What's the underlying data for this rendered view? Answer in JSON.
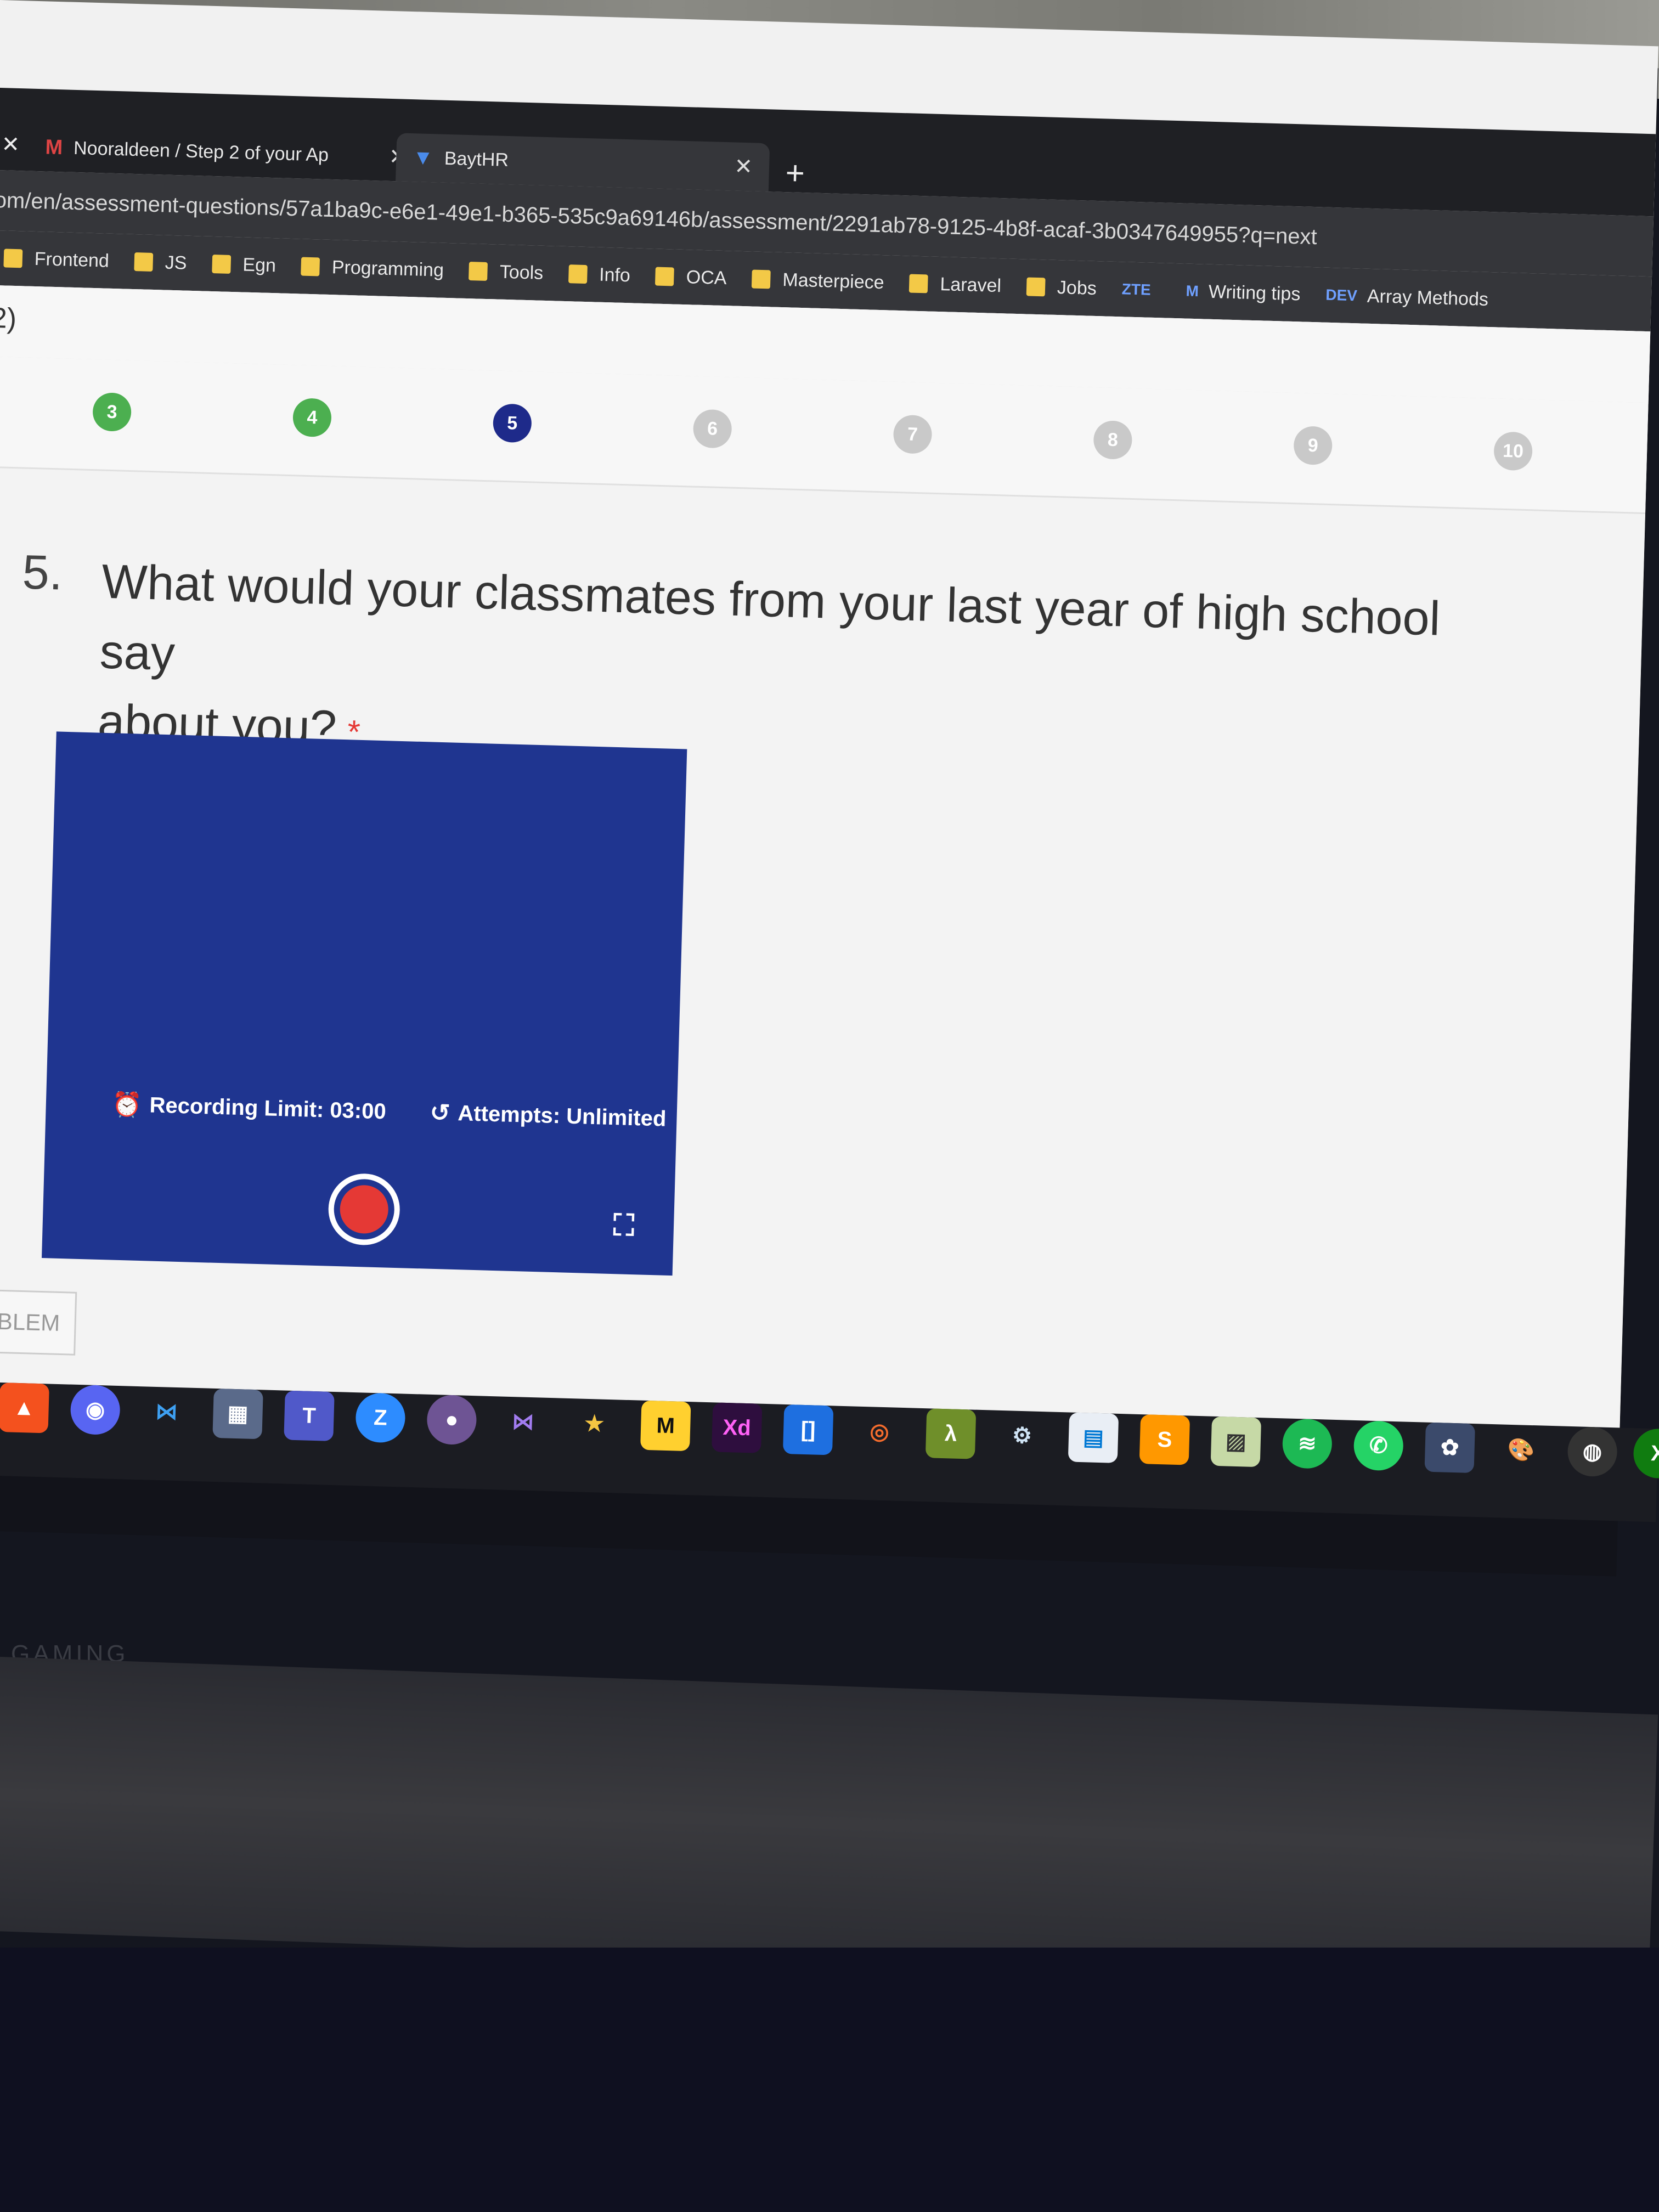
{
  "browser": {
    "tabs": [
      {
        "label": "Nooraldeen / Step 2 of your Ap",
        "icon": "gmail-icon"
      },
      {
        "label": "BaytHR",
        "icon": "bayt-icon",
        "active": true
      }
    ],
    "url": "om/en/assessment-questions/57a1ba9c-e6e1-49e1-b365-535c9a69146b/assessment/2291ab78-9125-4b8f-acaf-3b0347649955?q=next",
    "bookmarks": [
      "Frontend",
      "JS",
      "Egn",
      "Programming",
      "Tools",
      "Info",
      "OCA",
      "Masterpiece",
      "Laravel",
      "Jobs",
      "ZTE",
      "Writing tips",
      "Array Methods"
    ]
  },
  "page": {
    "header_fragment": "2)",
    "steps": [
      {
        "label": "3",
        "state": "done"
      },
      {
        "label": "4",
        "state": "done"
      },
      {
        "label": "5",
        "state": "current"
      },
      {
        "label": "6",
        "state": "todo"
      },
      {
        "label": "7",
        "state": "todo"
      },
      {
        "label": "8",
        "state": "todo"
      },
      {
        "label": "9",
        "state": "todo"
      },
      {
        "label": "10",
        "state": "todo"
      }
    ],
    "question": {
      "number": "5.",
      "line1": "What would your classmates from your last year of high school say",
      "line2": "about you?",
      "required_mark": "*"
    },
    "recorder": {
      "limit": "Recording Limit: 03:00",
      "attempts": "Attempts: Unlimited"
    },
    "problem_button": "OBLEM"
  },
  "taskbar": {
    "icons": [
      "brave-icon",
      "discord-icon",
      "vscode-icon",
      "calculator-icon",
      "teams-icon",
      "zoom-icon",
      "github-icon",
      "visualstudio-icon",
      "star-icon",
      "miro-icon",
      "xd-icon",
      "bracket-icon",
      "origin-icon",
      "lambda-icon",
      "steam-icon",
      "store-icon",
      "sublime-icon",
      "photo-icon",
      "spotify-icon",
      "whatsapp-icon",
      "davinci-icon",
      "paint-icon",
      "obs-icon",
      "xbox-icon"
    ],
    "xd_label": "Xd"
  },
  "laptop": {
    "brand_text": "GAMING"
  },
  "colors": {
    "recorder_bg": "#1f3590",
    "record_red": "#e53935",
    "step_done": "#4caf50",
    "step_current": "#1e2a8a"
  }
}
